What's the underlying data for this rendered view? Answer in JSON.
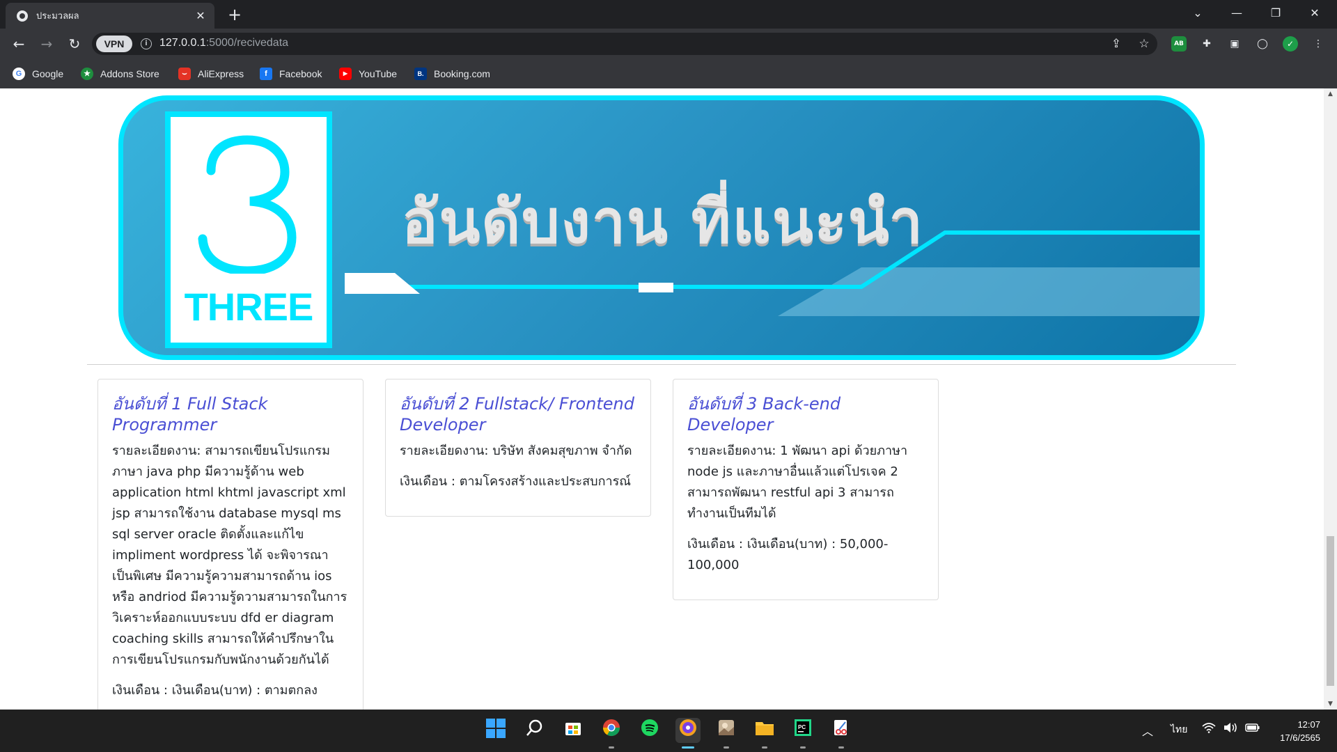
{
  "browser": {
    "tab_title": "ประมวลผล",
    "new_tab_symbol": "+",
    "url_host": "127.0.0.1",
    "url_rest": ":5000/recivedata",
    "vpn_label": "VPN",
    "bookmarks": [
      {
        "label": "Google",
        "color": "#ffffff",
        "glyph": "G"
      },
      {
        "label": "Addons Store",
        "color": "#1e8e3e",
        "glyph": "★"
      },
      {
        "label": "AliExpress",
        "color": "#e43225",
        "glyph": "⌣"
      },
      {
        "label": "Facebook",
        "color": "#1877f2",
        "glyph": "f"
      },
      {
        "label": "YouTube",
        "color": "#ff0000",
        "glyph": "▶"
      },
      {
        "label": "Booking.com",
        "color": "#003580",
        "glyph": "B."
      }
    ]
  },
  "banner": {
    "number_word": "THREE",
    "headline": "อันดับงาน ที่แนะนำ",
    "accent_color": "#00e5ff"
  },
  "jobs": [
    {
      "title": "อันดับที่ 1 Full Stack Programmer",
      "detail": "รายละเอียดงาน: สามารถเขียนโปรแกรมภาษา java php มีความรู้ด้าน web application html khtml javascript xml jsp สามารถใช้งาน database mysql ms sql server oracle ติดตั้งและแก้ไข impliment wordpress ได้ จะพิจารณาเป็นพิเศษ มีความรู้ความสามารถด้าน ios หรือ andriod มีความรู้ดวามสามารถในการวิเคราะห์ออกแบบระบบ dfd er diagram coaching skills สามารถให้คำปรึกษาในการเขียนโปรแกรมกับพนักงานด้วยกันได้",
      "salary": "เงินเดือน : เงินเดือน(บาท) : ตามตกลง"
    },
    {
      "title": "อันดับที่ 2 Fullstack/ Frontend Developer",
      "detail": "รายละเอียดงาน: บริษัท สังคมสุขภาพ จำกัด",
      "salary": "เงินเดือน : ตามโครงสร้างและประสบการณ์"
    },
    {
      "title": "อันดับที่ 3 Back-end Developer",
      "detail": "รายละเอียดงาน: 1 พัฒนา api ด้วยภาษา node js และภาษาอื่นแล้วแต่โปรเจค 2 สามารถพัฒนา restful api 3 สามารถทำงานเป็นทีมได้",
      "salary": "เงินเดือน : เงินเดือน(บาท) : 50,000-100,000"
    }
  ],
  "taskbar": {
    "language": "ไทย",
    "time": "12:07",
    "date": "17/6/2565"
  }
}
